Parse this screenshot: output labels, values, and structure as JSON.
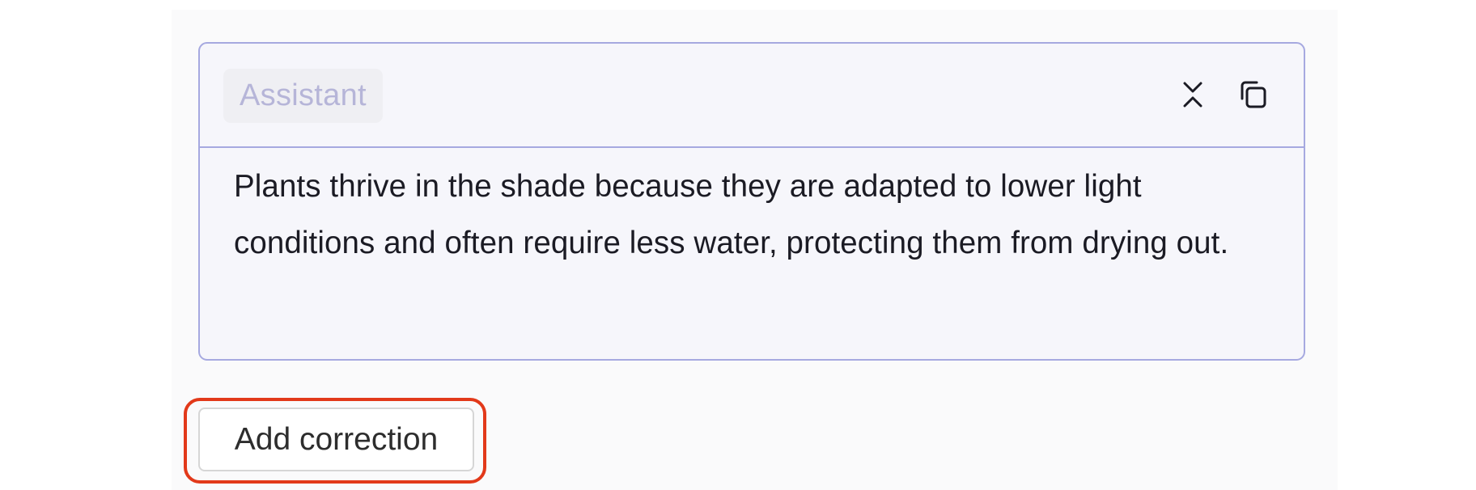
{
  "message": {
    "role_label": "Assistant",
    "text": "Plants thrive in the shade because they are adapted to lower light conditions and often require less water, protecting them from drying out.",
    "actions": {
      "collapse_icon": "collapse-icon",
      "copy_icon": "copy-icon"
    }
  },
  "footer": {
    "add_correction_label": "Add correction"
  },
  "colors": {
    "card_border": "#a6a9e0",
    "card_background": "#f6f6fb",
    "role_text": "#b6b5d8",
    "highlight": "#e2391a"
  }
}
